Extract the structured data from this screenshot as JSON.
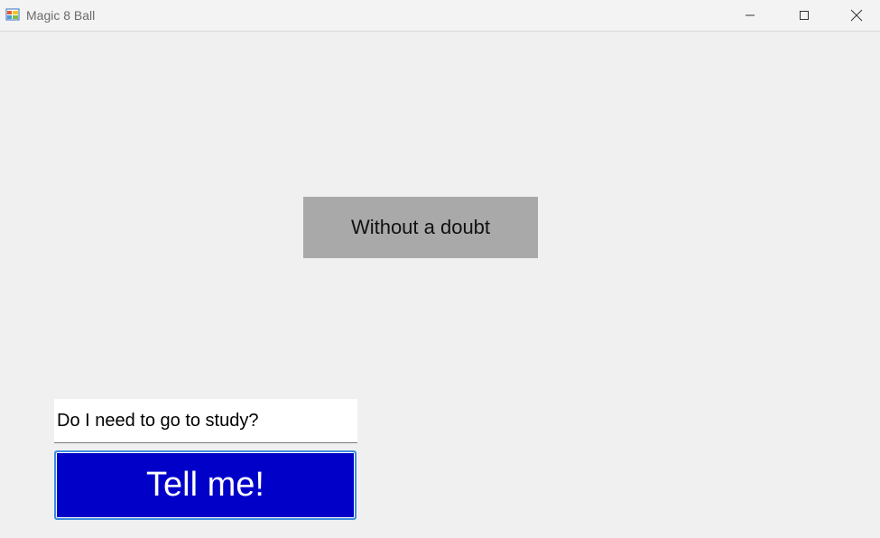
{
  "window": {
    "title": "Magic 8 Ball",
    "icon": "winforms-app-icon",
    "controls": {
      "minimize_icon": "minimize-icon",
      "maximize_icon": "maximize-icon",
      "close_icon": "close-icon"
    }
  },
  "answer": {
    "text": "Without a doubt",
    "background": "#a9a9a9"
  },
  "question": {
    "value": "Do I need to go to study?"
  },
  "tell_button": {
    "label": "Tell me!",
    "background": "#0000c8"
  }
}
